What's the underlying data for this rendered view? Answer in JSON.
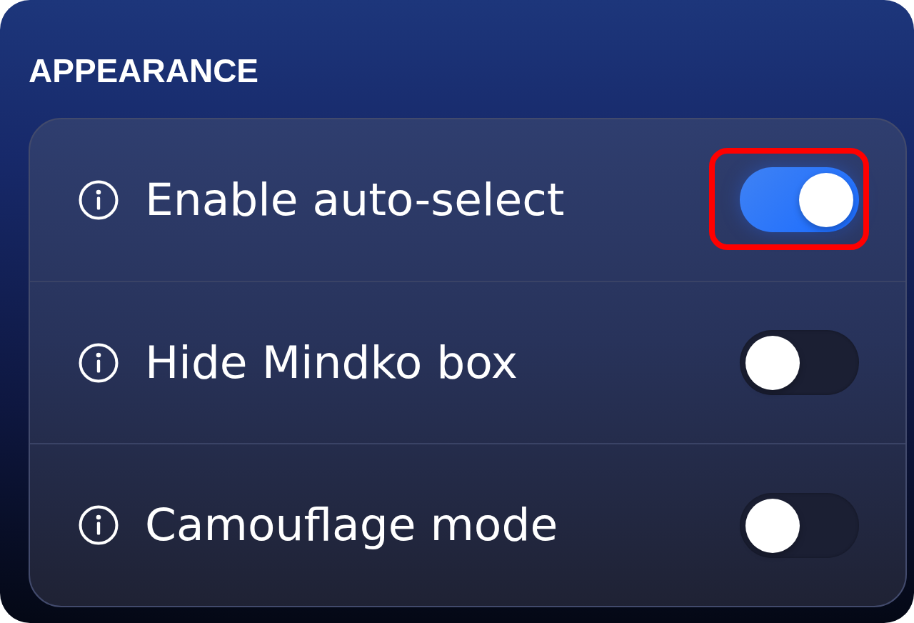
{
  "section": {
    "title": "APPEARANCE"
  },
  "settings": [
    {
      "label": "Enable auto-select",
      "on": true,
      "highlighted": true
    },
    {
      "label": "Hide Mindko box",
      "on": false,
      "highlighted": false
    },
    {
      "label": "Camouflage mode",
      "on": false,
      "highlighted": false
    }
  ]
}
